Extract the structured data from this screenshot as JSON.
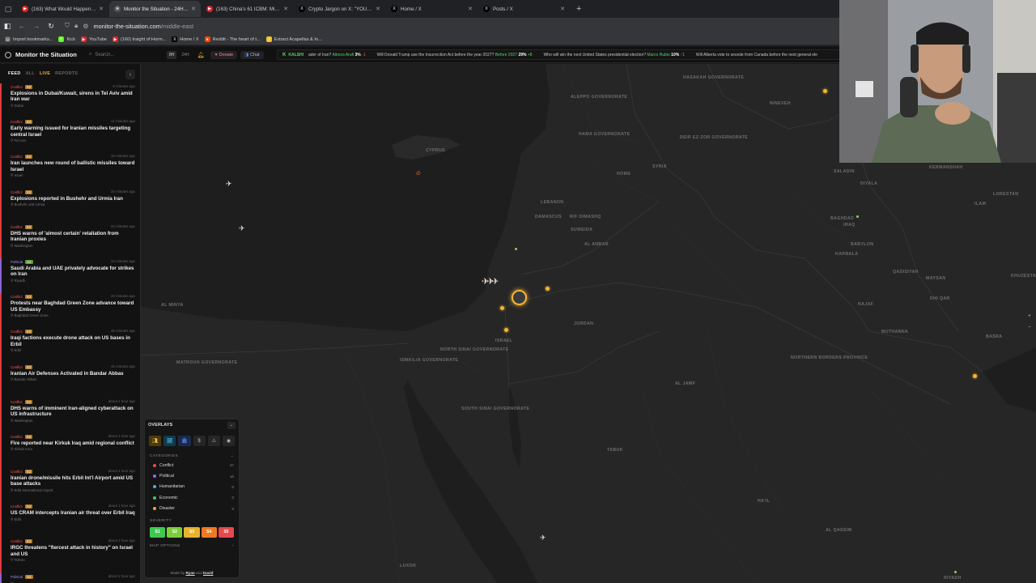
{
  "browser": {
    "tabs": [
      {
        "title": "(163) What Would Happen If U:",
        "active": false,
        "fav_color": "#e02424",
        "fav_glyph": "▶"
      },
      {
        "title": "Monitor the Situation - 24H Un",
        "active": true,
        "fav_color": "#555555",
        "fav_glyph": "⊕"
      },
      {
        "title": "(163) China's 61 ICBM: Missile I",
        "active": false,
        "fav_color": "#e02424",
        "fav_glyph": "▶"
      },
      {
        "title": "Crypto Jargon on X: \"YOU CAN",
        "active": false,
        "fav_color": "#000000",
        "fav_glyph": "X"
      },
      {
        "title": "Home / X",
        "active": false,
        "fav_color": "#000000",
        "fav_glyph": "X"
      },
      {
        "title": "Posts / X",
        "active": false,
        "fav_color": "#000000",
        "fav_glyph": "X"
      }
    ],
    "url_host": "monitor-the-situation.com",
    "url_path": "/middle-east",
    "bookmarks": [
      {
        "label": "Import bookmarks...",
        "color": "#555555",
        "glyph": "▤"
      },
      {
        "label": "Kick",
        "color": "#53fc18",
        "glyph": "K"
      },
      {
        "label": "YouTube",
        "color": "#e02424",
        "glyph": "▶"
      },
      {
        "label": "(160) traight of Horm...",
        "color": "#e02424",
        "glyph": "▶"
      },
      {
        "label": "Home / X",
        "color": "#000000",
        "glyph": "X"
      },
      {
        "label": "Reddit - The heart of t...",
        "color": "#ff4500",
        "glyph": "●"
      },
      {
        "label": "Extract Acapellas & In...",
        "color": "#f2c230",
        "glyph": "♪"
      }
    ]
  },
  "header": {
    "brand": "Monitor the Situation",
    "search_placeholder": "Search...",
    "range_label": "8H",
    "range_alt": "24H",
    "donate_label": "Donate",
    "chat_label": "Chat",
    "ticker_source": "KALSHI",
    "ticker": [
      {
        "q": "ader of Iran?",
        "name": "Alireza Arafi",
        "pct": "3%",
        "delta": "-1",
        "delta_color": "r"
      },
      {
        "q": "Will Donald Trump use the Insurrection Act before the year 2027?",
        "name": "Before 2027",
        "pct": "29%",
        "delta": "+8",
        "delta_color": "g"
      },
      {
        "q": "Who will win the next United States presidential election?",
        "name": "Marco Rubio",
        "pct": "10%",
        "delta": "↑1",
        "delta_color": "g"
      },
      {
        "q": "Will Alberta vote to secede from Canada before the next general ele",
        "name": "",
        "pct": "",
        "delta": "",
        "delta_color": "g"
      }
    ]
  },
  "sidebar": {
    "tabs": {
      "feed": "FEED",
      "all": "ALL",
      "live": "LIVE",
      "reports": "REPORTS"
    },
    "items": [
      {
        "cat": "Conflict",
        "sev": "S3",
        "time": "5 minutes ago",
        "title": "Explosions in Dubai/Kuwait, sirens in Tel Aviv amid Iran war",
        "loc": "Dubai"
      },
      {
        "cat": "Conflict",
        "sev": "S3",
        "time": "12 minutes ago",
        "title": "Early warning issued for Iranian missiles targeting central Israel",
        "loc": "Tel Aviv"
      },
      {
        "cat": "Conflict",
        "sev": "S3",
        "time": "15 minutes ago",
        "title": "Iran launches new round of ballistic missiles toward Israel",
        "loc": "Israel"
      },
      {
        "cat": "Conflict",
        "sev": "S3",
        "time": "20 minutes ago",
        "title": "Explosions reported in Bushehr and Urmia Iran",
        "loc": "Bushehr and Urmia"
      },
      {
        "cat": "Conflict",
        "sev": "S3",
        "time": "22 minutes ago",
        "title": "DHS warns of 'almost certain' retaliation from Iranian proxies",
        "loc": "Washington"
      },
      {
        "cat": "Political",
        "sev": "S2",
        "time": "24 minutes ago",
        "title": "Saudi Arabia and UAE privately advocate for strikes on Iran",
        "loc": "Riyadh"
      },
      {
        "cat": "Conflict",
        "sev": "S3",
        "time": "26 minutes ago",
        "title": "Protests near Baghdad Green Zone advance toward US Embassy",
        "loc": "Baghdad Green Zone"
      },
      {
        "cat": "Conflict",
        "sev": "S3",
        "time": "35 minutes ago",
        "title": "Iraqi factions execute drone attack on US bases in Erbil",
        "loc": "Erbil"
      },
      {
        "cat": "Conflict",
        "sev": "S3",
        "time": "45 minutes ago",
        "title": "Iranian Air Defenses Activated in Bandar Abbas",
        "loc": "Bandar Abbas"
      },
      {
        "cat": "Conflict",
        "sev": "S3",
        "time": "about 1 hour ago",
        "title": "DHS warns of imminent Iran-aligned cyberattack on US infrastructure",
        "loc": "Washington"
      },
      {
        "cat": "Conflict",
        "sev": "S3",
        "time": "about 1 hour ago",
        "title": "Fire reported near Kirkuk Iraq amid regional conflict",
        "loc": "Kirkuk Area"
      },
      {
        "cat": "Conflict",
        "sev": "S3",
        "time": "about 1 hour ago",
        "title": "Iranian drone/missile hits Erbil Int'l Airport amid US base attacks",
        "loc": "Erbil International Airport"
      },
      {
        "cat": "Conflict",
        "sev": "S3",
        "time": "about 1 hour ago",
        "title": "US CRAM intercepts Iranian air threat over Erbil Iraq",
        "loc": "Erbil"
      },
      {
        "cat": "Conflict",
        "sev": "S3",
        "time": "about 1 hour ago",
        "title": "IRGC threatens \"fiercest attack in history\" on Israel and US",
        "loc": "Tehran"
      },
      {
        "cat": "Political",
        "sev": "S3",
        "time": "about 1 hour ago",
        "title": "",
        "loc": ""
      }
    ]
  },
  "overlays": {
    "title": "OVERLAYS",
    "categories_label": "CATEGORIES",
    "categories": [
      {
        "name": "Conflict",
        "count": "47",
        "color": "#e5484d"
      },
      {
        "name": "Political",
        "count": "16",
        "color": "#8e6cf0"
      },
      {
        "name": "Humanitarian",
        "count": "0",
        "color": "#3fb8e6"
      },
      {
        "name": "Economic",
        "count": "0",
        "color": "#45c46b"
      },
      {
        "name": "Disaster",
        "count": "0",
        "color": "#f2a43a"
      }
    ],
    "severity_label": "SEVERITY",
    "severity": [
      {
        "label": "S1",
        "color": "#3fc94f"
      },
      {
        "label": "S2",
        "color": "#7bcf3b"
      },
      {
        "label": "S3",
        "color": "#e8b22a"
      },
      {
        "label": "S4",
        "color": "#f07a22"
      },
      {
        "label": "S5",
        "color": "#e5484d"
      }
    ],
    "map_options_label": "MAP OPTIONS",
    "footer_prefix": "Made by",
    "footer_a": "Ryan",
    "footer_and": "and",
    "footer_b": "David"
  },
  "map": {
    "labels": [
      {
        "t": "HASAKAH GOVERNORATE",
        "k": ""
      },
      {
        "t": "ALEPPO GOVERNORATE",
        "k": ""
      },
      {
        "t": "CYPRUS",
        "k": ""
      },
      {
        "t": "HAMA GOVERNORATE",
        "k": ""
      },
      {
        "t": "DEIR EZ-ZOR GOVERNORATE",
        "k": ""
      },
      {
        "t": "HOMS",
        "k": ""
      },
      {
        "t": "SYRIA",
        "k": ""
      },
      {
        "t": "LEBANON",
        "k": ""
      },
      {
        "t": "DAMASCUS",
        "k": ""
      },
      {
        "t": "RIF DIMASHQ",
        "k": ""
      },
      {
        "t": "SUWEIDA",
        "k": ""
      },
      {
        "t": "AL ANBAR",
        "k": ""
      },
      {
        "t": "IRAQ",
        "k": ""
      },
      {
        "t": "BABYLON",
        "k": ""
      },
      {
        "t": "KARBALA",
        "k": ""
      },
      {
        "t": "QADISIYAH",
        "k": ""
      },
      {
        "t": "DHI QAR",
        "k": ""
      },
      {
        "t": "MAYSAN",
        "k": ""
      },
      {
        "t": "KHUZESTAN",
        "k": ""
      },
      {
        "t": "NAJAF",
        "k": ""
      },
      {
        "t": "MUTHANNA",
        "k": ""
      },
      {
        "t": "BASRA",
        "k": ""
      },
      {
        "t": "JORDAN",
        "k": ""
      },
      {
        "t": "ISRAEL",
        "k": ""
      },
      {
        "t": "NORTH SINAI GOVERNORATE",
        "k": ""
      },
      {
        "t": "ISMAILIA GOVERNORATE",
        "k": ""
      },
      {
        "t": "MATROUH GOVERNORATE",
        "k": ""
      },
      {
        "t": "SOUTH SINAI GOVERNORATE",
        "k": ""
      },
      {
        "t": "NORTHERN BORDERS PROVINCE",
        "k": ""
      },
      {
        "t": "AL JAWF",
        "k": ""
      },
      {
        "t": "TABUK",
        "k": ""
      },
      {
        "t": "HA'IL",
        "k": ""
      },
      {
        "t": "AL QASSIM",
        "k": ""
      },
      {
        "t": "LUXOR",
        "k": ""
      },
      {
        "t": "RIYADH",
        "k": ""
      },
      {
        "t": "NINEVEH",
        "k": ""
      },
      {
        "t": "SALADIN",
        "k": ""
      },
      {
        "t": "DIYALA",
        "k": ""
      },
      {
        "t": "BAGHDAD",
        "k": ""
      },
      {
        "t": "KERMANSHAH",
        "k": ""
      },
      {
        "t": "LORESTAN",
        "k": ""
      },
      {
        "t": "ILAM",
        "k": ""
      },
      {
        "t": "AL MINYA",
        "k": ""
      }
    ]
  }
}
